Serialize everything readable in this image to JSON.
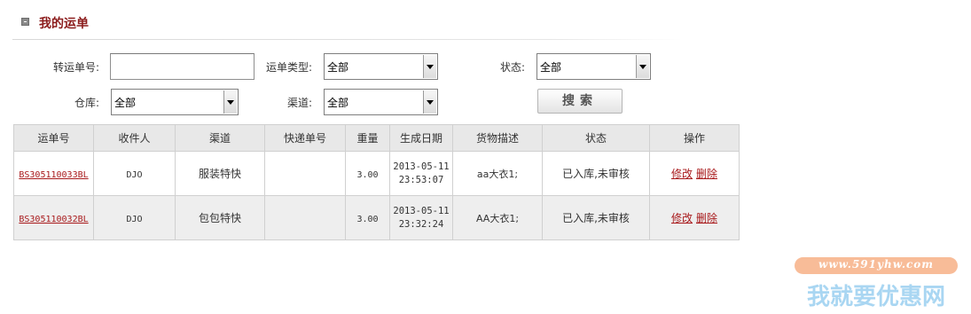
{
  "header": {
    "title": "我的运单"
  },
  "filters": {
    "tracking_label": "转运单号:",
    "tracking_value": "",
    "type_label": "运单类型:",
    "type_value": "全部",
    "status_label": "状态:",
    "status_value": "全部",
    "warehouse_label": "仓库:",
    "warehouse_value": "全部",
    "channel_label": "渠道:",
    "channel_value": "全部",
    "search_label": "搜索"
  },
  "table": {
    "headers": [
      "运单号",
      "收件人",
      "渠道",
      "快递单号",
      "重量",
      "生成日期",
      "货物描述",
      "状态",
      "操作"
    ],
    "rows": [
      {
        "order_no": "BS305110033BL",
        "recipient": "DJO",
        "channel": "服装特快",
        "express_no": "",
        "weight": "3.00",
        "date": "2013-05-11",
        "time": "23:53:07",
        "desc": "aa大衣1;",
        "status": "已入库,未审核",
        "edit": "修改",
        "delete": "删除"
      },
      {
        "order_no": "BS305110032BL",
        "recipient": "DJO",
        "channel": "包包特快",
        "express_no": "",
        "weight": "3.00",
        "date": "2013-05-11",
        "time": "23:32:24",
        "desc": "AA大衣1;",
        "status": "已入库,未审核",
        "edit": "修改",
        "delete": "删除"
      }
    ]
  },
  "watermark": {
    "url": "www.591yhw.com",
    "brand": "我就要优惠网"
  }
}
